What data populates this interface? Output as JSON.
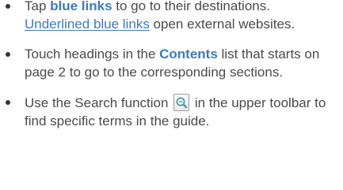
{
  "tips": [
    {
      "pre": "Tap ",
      "keyword": "blue links",
      "mid": " to go to their destinations. ",
      "link": "Underlined blue links",
      "post": " open external websites."
    },
    {
      "pre": "Touch headings in the ",
      "keyword": "Contents",
      "post": " list that starts on page 2 to go to the corresponding sections."
    },
    {
      "pre": "Use the Search function ",
      "icon": "search-zoom-icon",
      "post": " in the upper toolbar to find specific terms in the guide."
    }
  ],
  "colors": {
    "text": "#4a4a4a",
    "link": "#3b7bbf",
    "bullet": "#333333"
  }
}
